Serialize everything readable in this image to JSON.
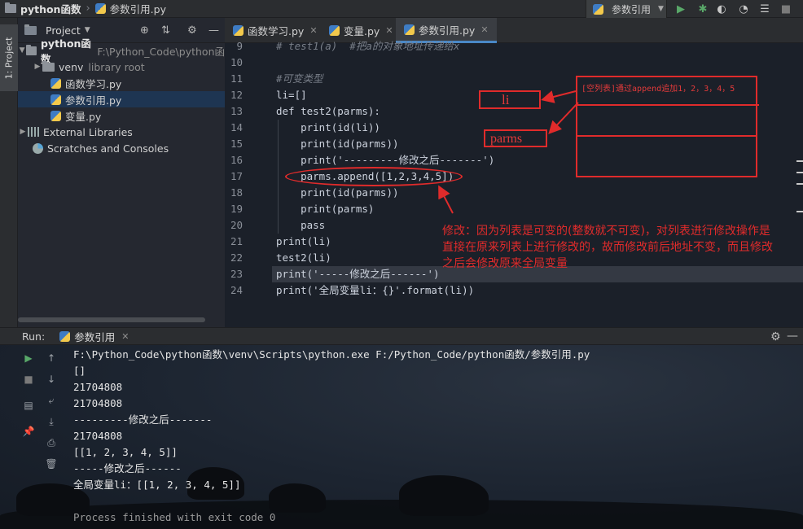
{
  "navbar": {
    "project": "python函数",
    "file": "参数引用.py",
    "run_config": "参数引用"
  },
  "left_strip": {
    "project_tab": "1: Project"
  },
  "project_panel": {
    "title": "Project",
    "tree": [
      {
        "label": "python函数",
        "sub": "F:\\Python_Code\\python函"
      },
      {
        "label": "venv",
        "sub": "library root"
      },
      {
        "label": "函数学习.py",
        "sub": ""
      },
      {
        "label": "参数引用.py",
        "sub": ""
      },
      {
        "label": "变量.py",
        "sub": ""
      },
      {
        "label": "External Libraries",
        "sub": ""
      },
      {
        "label": "Scratches and Consoles",
        "sub": ""
      }
    ]
  },
  "editor": {
    "tabs": [
      {
        "label": "函数学习.py"
      },
      {
        "label": "变量.py"
      },
      {
        "label": "参数引用.py"
      }
    ],
    "line_numbers": [
      "9",
      "10",
      "11",
      "12",
      "13",
      "14",
      "15",
      "16",
      "17",
      "18",
      "19",
      "20",
      "21",
      "22",
      "23",
      "24"
    ],
    "code": [
      "# test1(a)  #把a的对象地址传递给x",
      "",
      "#可变类型",
      "li=[]",
      "def test2(parms):",
      "    print(id(li))",
      "    print(id(parms))",
      "    print('---------修改之后-------')",
      "    parms.append([1,2,3,4,5])",
      "    print(id(parms))",
      "    print(parms)",
      "    pass",
      "print(li)",
      "test2(li)",
      "print('-----修改之后------')",
      "print('全局变量li：{}'.format(li))"
    ]
  },
  "annotations": {
    "li_label": "li",
    "parms_label": "parms",
    "memory_text": "[空列表]通过append追加1，2，3，4，5",
    "explanation": [
      "修改：因为列表是可变的(整数就不可变)，对列表进行修改操作是",
      "直接在原来列表上进行修改的，故而修改前后地址不变，而且修改",
      "之后会修改原来全局变量"
    ]
  },
  "run_panel": {
    "label": "Run:",
    "tab": "参数引用",
    "output": [
      "F:\\Python_Code\\python函数\\venv\\Scripts\\python.exe F:/Python_Code/python函数/参数引用.py",
      "[]",
      "21704808",
      "21704808",
      "---------修改之后-------",
      "21704808",
      "[[1, 2, 3, 4, 5]]",
      "-----修改之后------",
      "全局变量li：[[1, 2, 3, 4, 5]]",
      "",
      "Process finished with exit code 0"
    ]
  },
  "colors": {
    "annotation_red": "#e02b2b",
    "selection": "#1e3552",
    "accent_tab": "#4a88c7"
  }
}
